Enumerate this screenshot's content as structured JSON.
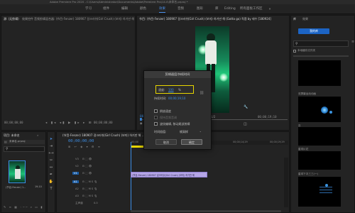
{
  "titlebar": {
    "text": "Adobe Premiere Pro 2020 - C:\\Users\\Administrator\\Documents\\Adobe\\Premiere Pro\\14.0\\未命名.prproj *"
  },
  "workspaces": {
    "items": [
      {
        "label": "学习"
      },
      {
        "label": "组件"
      },
      {
        "label": "编辑"
      },
      {
        "label": "颜色"
      },
      {
        "label": "效果"
      },
      {
        "label": "音频"
      },
      {
        "label": "图形"
      },
      {
        "label": "库"
      },
      {
        "label": "Editing"
      },
      {
        "label": "所有面板工作区"
      }
    ],
    "active_index": 4
  },
  "source_panel": {
    "tab_source": "源: (无剪辑)",
    "tab_effects": "效果控件",
    "tab_mixer": "音频剪辑混合器: (节目-Fenzer) 180907 걸크러쉬(Girl Crush) (보미) 하기만 해 (Gotta go) ...",
    "tc_left": "00;00;00;00",
    "tc_right": "00;00;00;00"
  },
  "program_panel": {
    "title": "节目: (节目-Fenzer) 180907 걸크러쉬(Girl Crush) (보미) 하기만 해 (Gotta go) 직캠 by 태수 [180924]",
    "tc_left": "00;00;00;00",
    "zoom": "1/2",
    "tc_right": "00;00;19;10"
  },
  "project_panel": {
    "tab": "项目: 未命名",
    "file": "未命名.prproj",
    "clip_label": "(节目-Fenzer) 1...",
    "clip_duration": "19;10"
  },
  "timeline": {
    "tab": "(节目-Fenzer) 180907 걸크러쉬(Girl Crush) (보미) 하기만 해 ...",
    "timecode": "00;00;00;00",
    "ruler": [
      ":00;00",
      "00;00;04;29",
      "00;00;09;29",
      "00;00;14;29",
      "00;00;19;29"
    ],
    "tracks": [
      "V3",
      "V2",
      "V1",
      "A1",
      "A2",
      "A3",
      "主声道"
    ],
    "master_value": "0.0",
    "clip_label": "(节目-Fenzer) 180907 걸크러쉬(Girl Crush) (보미) 하기만 해"
  },
  "dialog": {
    "title": "剪辑速度/持续时间",
    "speed_label": "速度:",
    "speed_value": "100",
    "speed_unit": "%",
    "duration_label": "持续时间:",
    "duration_value": "00;00;19;10",
    "reverse": "倒放速度",
    "keep_pitch": "保持音频音调",
    "ripple": "波纹编辑, 移动尾部剪辑",
    "interp_label": "时间插值:",
    "interp_value": "帧采样",
    "cancel": "取消",
    "ok": "确定"
  },
  "right_panel": {
    "tab_library": "库",
    "tab_effects": "效果",
    "lib_button": "我的库",
    "search_placeholder": "",
    "check_label": "本地缓存文件夹",
    "item2": "双屏幕运动动画",
    "item3": "灰",
    "item4": "星球片花",
    "item5": "星球下次三三(一)"
  },
  "colors": {
    "accent": "#3c8ee6",
    "clip_purple": "#b5a6e6",
    "speed_box": "#e8d600",
    "ws_active": "#4a8fe8"
  }
}
